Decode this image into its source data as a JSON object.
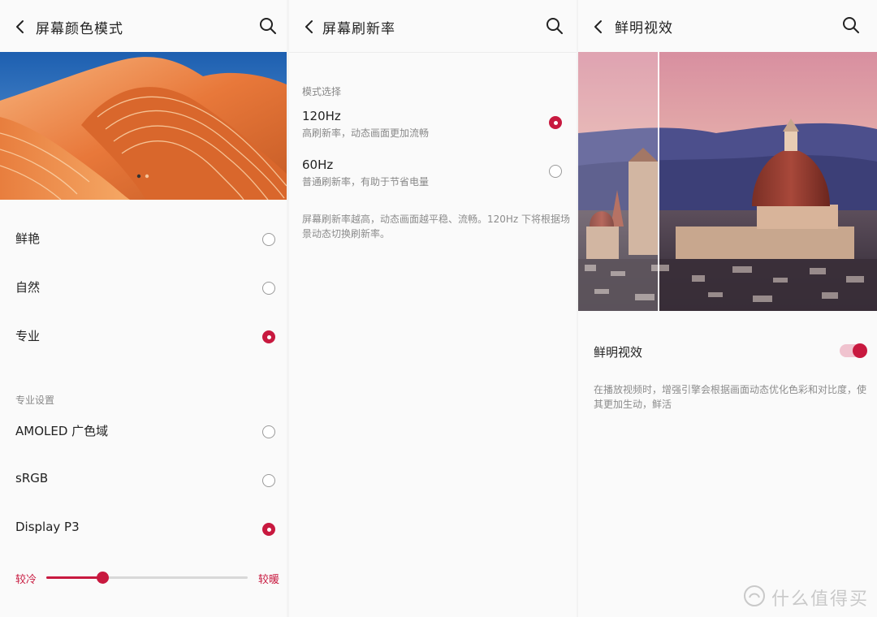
{
  "colors": {
    "accent": "#c8193f",
    "bg": "#fafafa",
    "text": "#222222",
    "muted": "#888888"
  },
  "panel1": {
    "title": "屏幕颜色模式",
    "back_icon": "chevron-left-icon",
    "search_icon": "search-icon",
    "options": [
      {
        "label": "鲜艳",
        "selected": false
      },
      {
        "label": "自然",
        "selected": false
      },
      {
        "label": "专业",
        "selected": true
      }
    ],
    "pro_section_title": "专业设置",
    "pro_options": [
      {
        "label": "AMOLED 广色域",
        "selected": false
      },
      {
        "label": "sRGB",
        "selected": false
      },
      {
        "label": "Display P3",
        "selected": true
      }
    ],
    "slider": {
      "left_label": "较冷",
      "right_label": "较暖",
      "value": 0.28
    }
  },
  "panel2": {
    "title": "屏幕刷新率",
    "section_title": "模式选择",
    "options": [
      {
        "label": "120Hz",
        "sub": "高刷新率，动态画面更加流畅",
        "selected": true
      },
      {
        "label": "60Hz",
        "sub": "普通刷新率，有助于节省电量",
        "selected": false
      }
    ],
    "note": "屏幕刷新率越高，动态画面越平稳、流畅。120Hz 下将根据场景动态切换刷新率。"
  },
  "panel3": {
    "title": "鲜明视效",
    "toggle_label": "鲜明视效",
    "toggle_on": true,
    "note": "在播放视频时，增强引擎会根据画面动态优化色彩和对比度，使其更加生动，鲜活"
  },
  "watermark": {
    "text": "什么值得买"
  }
}
